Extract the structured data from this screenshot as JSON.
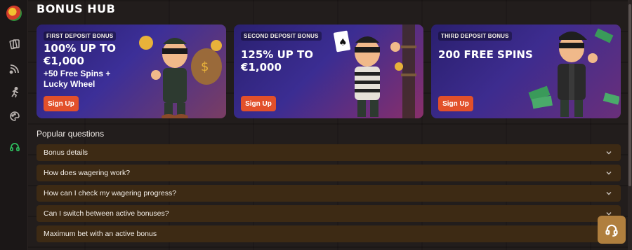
{
  "page": {
    "title": "BONUS HUB"
  },
  "sidebar": {
    "icons": [
      "app-logo-icon",
      "cards-icon",
      "live-icon",
      "runner-icon",
      "palette-icon",
      "support-icon"
    ],
    "active_color": "#2fbf5f"
  },
  "cards": [
    {
      "label": "FIRST DEPOSIT BONUS",
      "title": "100% UP TO €1,000",
      "subtitle": "+50 Free Spins + Lucky Wheel",
      "button": "Sign Up"
    },
    {
      "label": "SECOND DEPOSIT BONUS",
      "title": "125% UP TO €1,000",
      "subtitle": "",
      "button": "Sign Up"
    },
    {
      "label": "THIRD DEPOSIT BONUS",
      "title": "200 FREE SPINS",
      "subtitle": "",
      "button": "Sign Up"
    }
  ],
  "faq": {
    "heading": "Popular questions",
    "items": [
      "Bonus details",
      "How does wagering work?",
      "How can I check my wagering progress?",
      "Can I switch between active bonuses?",
      "Maximum bet with an active bonus"
    ]
  },
  "colors": {
    "accent_button": "#e2502a",
    "faq_row": "#3d2a14",
    "support_button": "#b07f3e"
  }
}
